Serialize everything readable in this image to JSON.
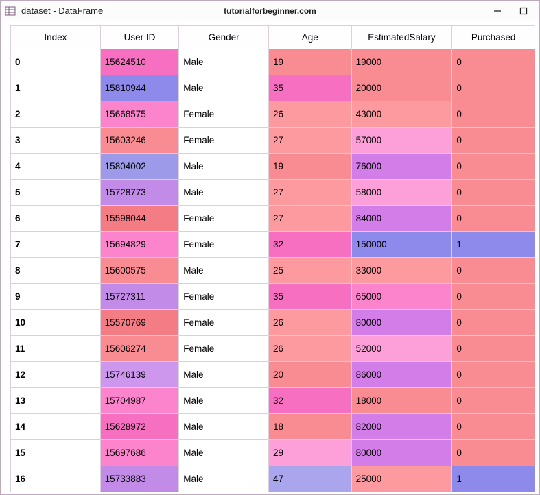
{
  "window": {
    "title": "dataset - DataFrame",
    "watermark": "tutorialforbeginner.com"
  },
  "columns": [
    "Index",
    "User ID",
    "Gender",
    "Age",
    "EstimatedSalary",
    "Purchased"
  ],
  "colors": {
    "coralDeep": "#f47d85",
    "coral": "#f98b92",
    "coralLight": "#fc9aa0",
    "pinkDeep": "#f76fc0",
    "pink": "#fb84cc",
    "pinkLight": "#fd9fd9",
    "orchid": "#d37de9",
    "lilac": "#c28be8",
    "lilacLight": "#cd97ee",
    "periwinkle": "#9d9ae9",
    "periwinkleLight": "#a9a6ed",
    "blue": "#8e8aeb"
  },
  "rows": [
    {
      "index": "0",
      "user_id": "15624510",
      "gender": "Male",
      "age": "19",
      "salary": "19000",
      "purchased": "0",
      "c_user": "pinkDeep",
      "c_age": "coral",
      "c_salary": "coral",
      "c_purch": "coral"
    },
    {
      "index": "1",
      "user_id": "15810944",
      "gender": "Male",
      "age": "35",
      "salary": "20000",
      "purchased": "0",
      "c_user": "blue",
      "c_age": "pinkDeep",
      "c_salary": "coral",
      "c_purch": "coral"
    },
    {
      "index": "2",
      "user_id": "15668575",
      "gender": "Female",
      "age": "26",
      "salary": "43000",
      "purchased": "0",
      "c_user": "pink",
      "c_age": "coralLight",
      "c_salary": "coralLight",
      "c_purch": "coral"
    },
    {
      "index": "3",
      "user_id": "15603246",
      "gender": "Female",
      "age": "27",
      "salary": "57000",
      "purchased": "0",
      "c_user": "coral",
      "c_age": "coralLight",
      "c_salary": "pinkLight",
      "c_purch": "coral"
    },
    {
      "index": "4",
      "user_id": "15804002",
      "gender": "Male",
      "age": "19",
      "salary": "76000",
      "purchased": "0",
      "c_user": "periwinkle",
      "c_age": "coral",
      "c_salary": "orchid",
      "c_purch": "coral"
    },
    {
      "index": "5",
      "user_id": "15728773",
      "gender": "Male",
      "age": "27",
      "salary": "58000",
      "purchased": "0",
      "c_user": "lilac",
      "c_age": "coralLight",
      "c_salary": "pinkLight",
      "c_purch": "coral"
    },
    {
      "index": "6",
      "user_id": "15598044",
      "gender": "Female",
      "age": "27",
      "salary": "84000",
      "purchased": "0",
      "c_user": "coralDeep",
      "c_age": "coralLight",
      "c_salary": "orchid",
      "c_purch": "coral"
    },
    {
      "index": "7",
      "user_id": "15694829",
      "gender": "Female",
      "age": "32",
      "salary": "150000",
      "purchased": "1",
      "c_user": "pink",
      "c_age": "pinkDeep",
      "c_salary": "blue",
      "c_purch": "blue"
    },
    {
      "index": "8",
      "user_id": "15600575",
      "gender": "Male",
      "age": "25",
      "salary": "33000",
      "purchased": "0",
      "c_user": "coral",
      "c_age": "coralLight",
      "c_salary": "coralLight",
      "c_purch": "coral"
    },
    {
      "index": "9",
      "user_id": "15727311",
      "gender": "Female",
      "age": "35",
      "salary": "65000",
      "purchased": "0",
      "c_user": "lilac",
      "c_age": "pinkDeep",
      "c_salary": "pink",
      "c_purch": "coral"
    },
    {
      "index": "10",
      "user_id": "15570769",
      "gender": "Female",
      "age": "26",
      "salary": "80000",
      "purchased": "0",
      "c_user": "coralDeep",
      "c_age": "coralLight",
      "c_salary": "orchid",
      "c_purch": "coral"
    },
    {
      "index": "11",
      "user_id": "15606274",
      "gender": "Female",
      "age": "26",
      "salary": "52000",
      "purchased": "0",
      "c_user": "coral",
      "c_age": "coralLight",
      "c_salary": "pinkLight",
      "c_purch": "coral"
    },
    {
      "index": "12",
      "user_id": "15746139",
      "gender": "Male",
      "age": "20",
      "salary": "86000",
      "purchased": "0",
      "c_user": "lilacLight",
      "c_age": "coral",
      "c_salary": "orchid",
      "c_purch": "coral"
    },
    {
      "index": "13",
      "user_id": "15704987",
      "gender": "Male",
      "age": "32",
      "salary": "18000",
      "purchased": "0",
      "c_user": "pink",
      "c_age": "pinkDeep",
      "c_salary": "coral",
      "c_purch": "coral"
    },
    {
      "index": "14",
      "user_id": "15628972",
      "gender": "Male",
      "age": "18",
      "salary": "82000",
      "purchased": "0",
      "c_user": "pinkDeep",
      "c_age": "coral",
      "c_salary": "orchid",
      "c_purch": "coral"
    },
    {
      "index": "15",
      "user_id": "15697686",
      "gender": "Male",
      "age": "29",
      "salary": "80000",
      "purchased": "0",
      "c_user": "pink",
      "c_age": "pinkLight",
      "c_salary": "orchid",
      "c_purch": "coral"
    },
    {
      "index": "16",
      "user_id": "15733883",
      "gender": "Male",
      "age": "47",
      "salary": "25000",
      "purchased": "1",
      "c_user": "lilac",
      "c_age": "periwinkleLight",
      "c_salary": "coralLight",
      "c_purch": "blue"
    }
  ]
}
